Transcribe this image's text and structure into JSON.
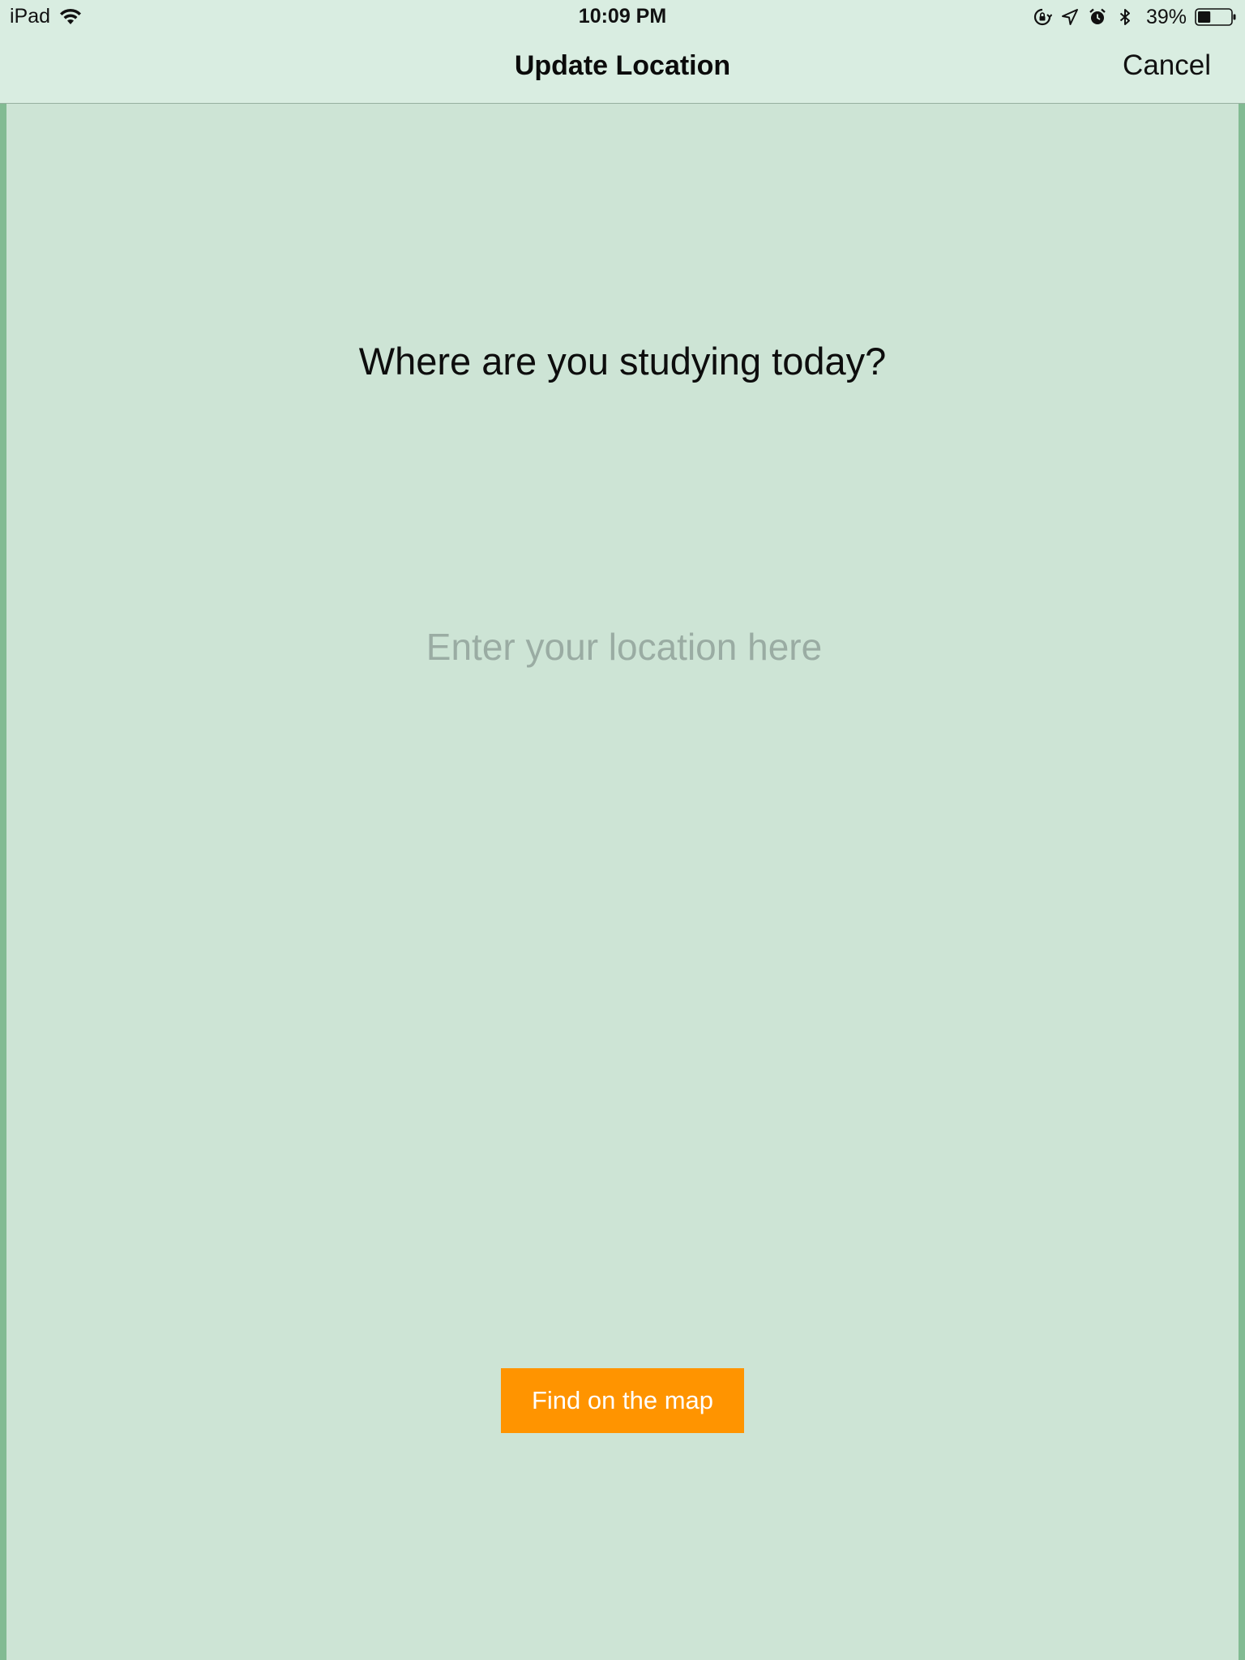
{
  "status_bar": {
    "device": "iPad",
    "time": "10:09 PM",
    "battery_percent": "39%",
    "battery_level": 0.39,
    "icons": [
      "wifi-icon",
      "rotation-lock-icon",
      "location-arrow-icon",
      "alarm-icon",
      "bluetooth-icon",
      "battery-icon"
    ]
  },
  "nav": {
    "title": "Update Location",
    "cancel_label": "Cancel"
  },
  "main": {
    "question": "Where are you studying today?",
    "location_input": {
      "value": "",
      "placeholder": "Enter your location here"
    },
    "map_button_label": "Find on the map"
  },
  "colors": {
    "background": "#cde4d5",
    "header": "#d9ede1",
    "accent": "#ff9400",
    "edge": "#82bb93",
    "placeholder": "#9aaca3"
  }
}
